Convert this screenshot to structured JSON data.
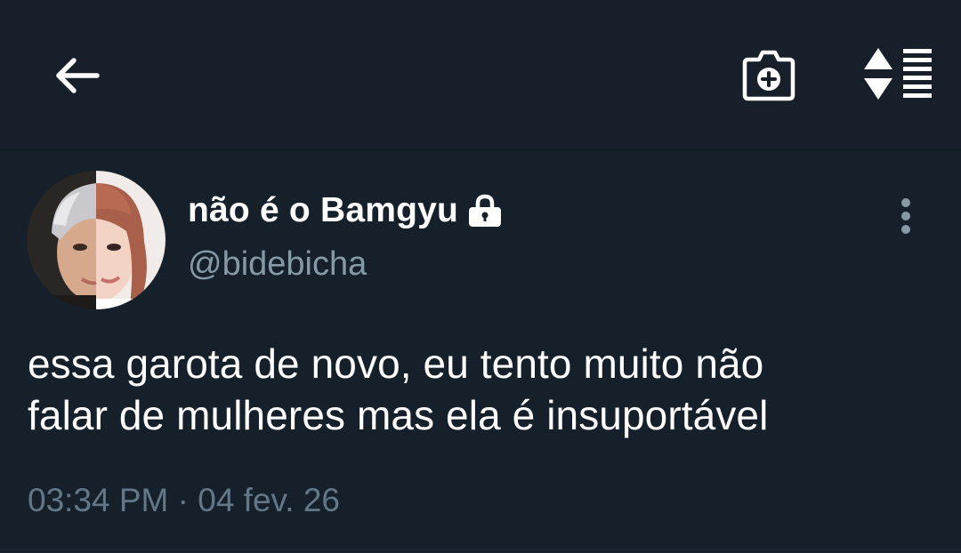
{
  "header": {
    "back_icon": "arrow-left-icon",
    "camera_icon": "camera-plus-icon",
    "sort_icon": "sort-list-icon"
  },
  "tweet": {
    "display_name": "não é o Bamgyu",
    "protected_icon": "lock-icon",
    "handle": "@bidebicha",
    "text": "essa garota de novo, eu tento muito não\nfalar de mulheres mas ela é insuportável",
    "timestamp": "03:34 PM · 04 fev. 26",
    "more_icon": "more-vertical-icon"
  },
  "colors": {
    "background": "#15202b",
    "header_background": "#17202a",
    "primary_text": "#ffffff",
    "secondary_text": "#8899a6",
    "timestamp_text": "#657786"
  }
}
